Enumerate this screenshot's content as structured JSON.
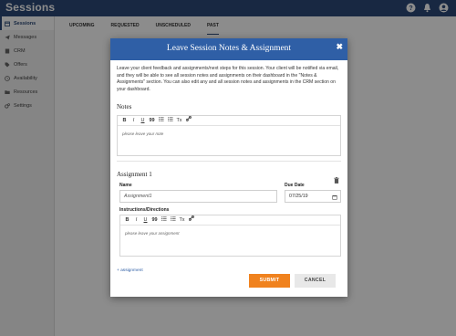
{
  "app": {
    "title": "Sessions"
  },
  "topbar": {
    "icons": [
      "help-icon",
      "notifications-icon",
      "user-avatar-icon"
    ]
  },
  "sidebar": {
    "items": [
      {
        "label": "Sessions",
        "icon": "calendar-icon",
        "active": true
      },
      {
        "label": "Messages",
        "icon": "paper-plane-icon"
      },
      {
        "label": "CRM",
        "icon": "contacts-icon"
      },
      {
        "label": "Offers",
        "icon": "tag-icon"
      },
      {
        "label": "Availability",
        "icon": "clock-icon"
      },
      {
        "label": "Resources",
        "icon": "folder-icon"
      },
      {
        "label": "Settings",
        "icon": "gears-icon"
      }
    ]
  },
  "tabs": [
    {
      "label": "UPCOMING"
    },
    {
      "label": "REQUESTED"
    },
    {
      "label": "UNSCHEDULED"
    },
    {
      "label": "PAST",
      "active": true
    }
  ],
  "modal": {
    "title": "Leave Session Notes & Assignment",
    "close": "✖",
    "intro": "Leave your client feedback and assignments/next steps for this session. Your client will be notified via email, and they will be able to see all session notes and assignments on their dashboard in the \"Notes & Assignments\" section. You can also edit any and all session notes and assignments in the CRM section on your dashboard.",
    "notes": {
      "label": "Notes",
      "placeholder": "please leave your note"
    },
    "toolbar": [
      "B",
      "I",
      "U",
      "99",
      "list-ul",
      "list-ol",
      "Tx",
      "link"
    ],
    "assignment": {
      "heading": "Assignment 1",
      "name_label": "Name",
      "name_value": "Assignment1",
      "due_label": "Due Date",
      "due_value": "07/25/19",
      "instructions_label": "Instructions/Directions",
      "instructions_placeholder": "please leave your assignment"
    },
    "add_assignment": "+ assignment",
    "submit_label": "SUBMIT",
    "cancel_label": "CANCEL"
  },
  "colors": {
    "primary": "#2c4a78",
    "header": "#2f5fa6",
    "accent": "#f0821e"
  }
}
